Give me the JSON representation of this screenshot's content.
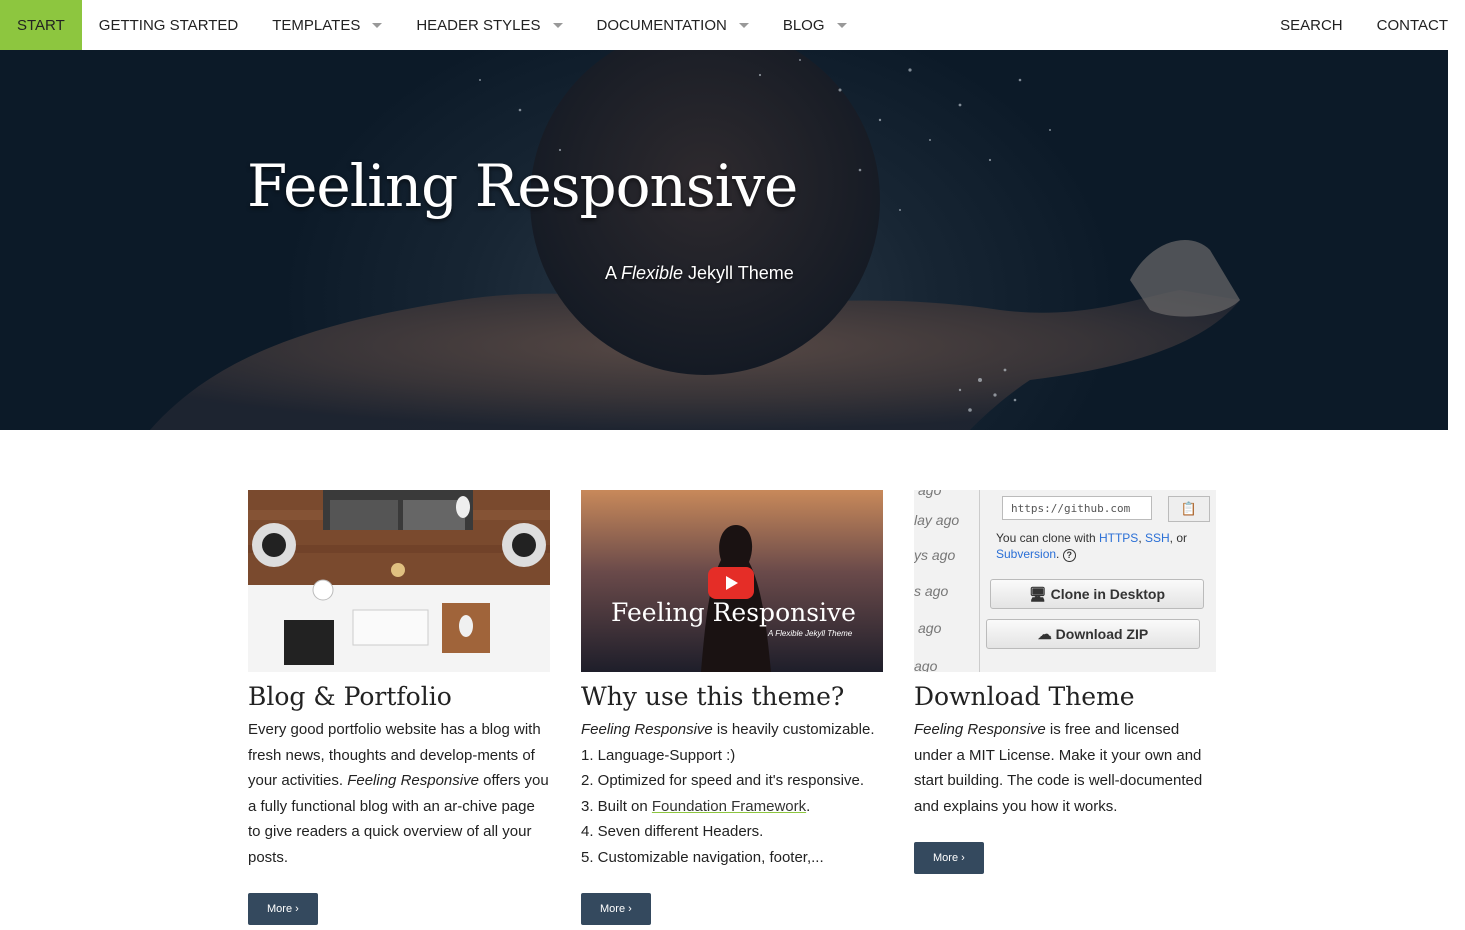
{
  "nav": {
    "items": [
      {
        "label": "START",
        "active": true,
        "dropdown": false
      },
      {
        "label": "GETTING STARTED",
        "active": false,
        "dropdown": false
      },
      {
        "label": "TEMPLATES",
        "active": false,
        "dropdown": true
      },
      {
        "label": "HEADER STYLES",
        "active": false,
        "dropdown": true
      },
      {
        "label": "DOCUMENTATION",
        "active": false,
        "dropdown": true
      },
      {
        "label": "BLOG",
        "active": false,
        "dropdown": true
      }
    ],
    "right": [
      {
        "label": "SEARCH"
      },
      {
        "label": "CONTACT"
      }
    ],
    "accent_color": "#8dc63f"
  },
  "hero": {
    "title": "Feeling Responsive",
    "subtitle_prefix": "A ",
    "subtitle_em": "Flexible",
    "subtitle_suffix": " Jekyll Theme"
  },
  "cards": [
    {
      "title": "Blog & Portfolio",
      "text_1": "Every good portfolio website has a blog with fresh news, thoughts and develop-ments of your activities. ",
      "text_em": "Feeling Responsive",
      "text_2": " offers you a fully functional blog with an ar-chive page to give readers a quick overview of all your posts.",
      "button": "More ›"
    },
    {
      "title": "Why use this theme?",
      "video_title": "Feeling Responsive",
      "video_subtitle": "A Flexible Jekyll Theme",
      "intro_em": "Feeling Responsive",
      "intro_rest": " is heavily customizable.",
      "list": [
        "1. Language-Support :)",
        "2. Optimized for speed and it's responsive.",
        "3. Built on ",
        "4. Seven different Headers.",
        "5. Customizable navigation, footer,..."
      ],
      "link_text": "Foundation Framework",
      "link_suffix": ".",
      "button": "More ›"
    },
    {
      "title": "Download Theme",
      "text_em": "Feeling Responsive",
      "text_rest": " is free and licensed under a MIT License. Make it your own and start building. The code is well-documented and explains you how it works.",
      "button": "More ›",
      "image": {
        "url": "https://github.com",
        "note_1": "You can clone with ",
        "https": "HTTPS",
        "comma": ", ",
        "ssh": "SSH",
        "note_2": ", or ",
        "svn": "Subversion",
        "note_3": ".",
        "help": "?",
        "clone_btn": "Clone in Desktop",
        "zip_btn": "Download ZIP",
        "ago_labels": [
          "ago",
          "lay ago",
          "ys ago",
          "s ago",
          "ago",
          "ago"
        ]
      }
    }
  ],
  "colors": {
    "button_bg": "#34495e",
    "link_underline": "#8dc63f"
  }
}
